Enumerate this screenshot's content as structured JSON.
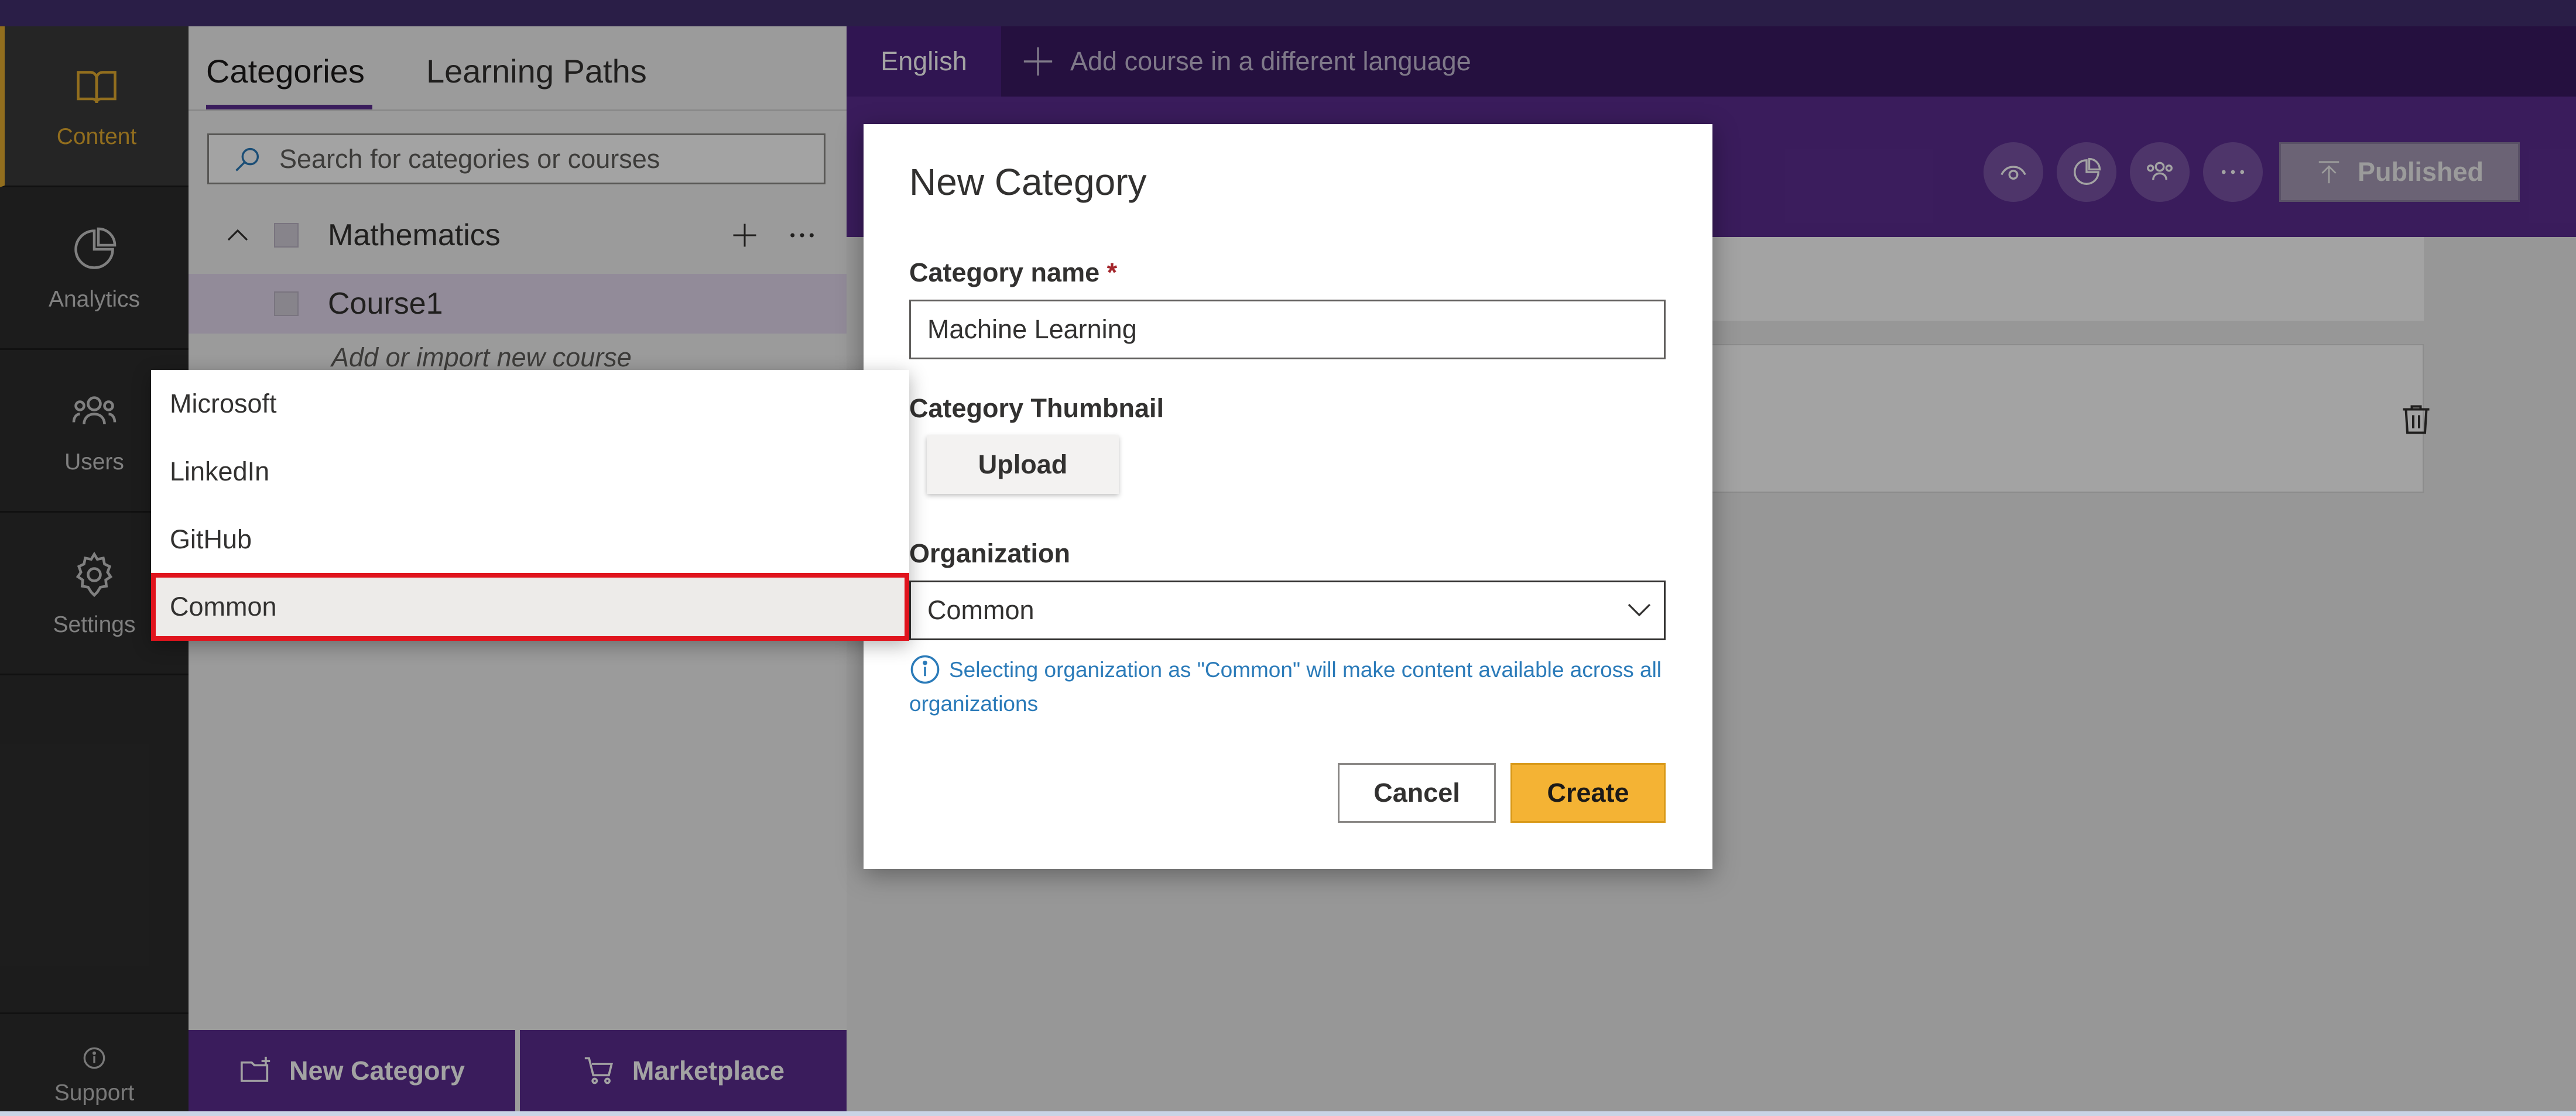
{
  "sidebar": {
    "items": [
      {
        "label": "Content",
        "icon": "book-icon",
        "active": true
      },
      {
        "label": "Analytics",
        "icon": "pie-chart-icon"
      },
      {
        "label": "Users",
        "icon": "users-icon"
      },
      {
        "label": "Settings",
        "icon": "gear-icon"
      }
    ],
    "support_label": "Support"
  },
  "category_panel": {
    "tabs": [
      {
        "label": "Categories",
        "active": true
      },
      {
        "label": "Learning Paths"
      }
    ],
    "search_placeholder": "Search for categories or courses",
    "tree": {
      "category": "Mathematics",
      "course": "Course1",
      "add_course_label": "Add or import new course"
    },
    "new_category_label": "New Category",
    "marketplace_label": "Marketplace"
  },
  "language_bar": {
    "current": "English",
    "add_label": "Add course in a different language"
  },
  "header": {
    "published_label": "Published"
  },
  "modal": {
    "title": "New Category",
    "name_label": "Category name",
    "required_marker": "*",
    "name_value": "Machine Learning",
    "thumbnail_label": "Category Thumbnail",
    "upload_label": "Upload",
    "organization_label": "Organization",
    "organization_value": "Common",
    "organization_note": "Selecting organization as \"Common\" will make content available across all organizations",
    "cancel_label": "Cancel",
    "create_label": "Create"
  },
  "dropdown": {
    "options": [
      "Microsoft",
      "LinkedIn",
      "GitHub",
      "Common"
    ],
    "selected": "Common"
  },
  "colors": {
    "brand_purple": "#5c2d91",
    "accent_gold": "#e5ad2f",
    "create_button": "#f4b334",
    "highlight_red": "#e0141d",
    "info_blue": "#2b7bb9"
  }
}
